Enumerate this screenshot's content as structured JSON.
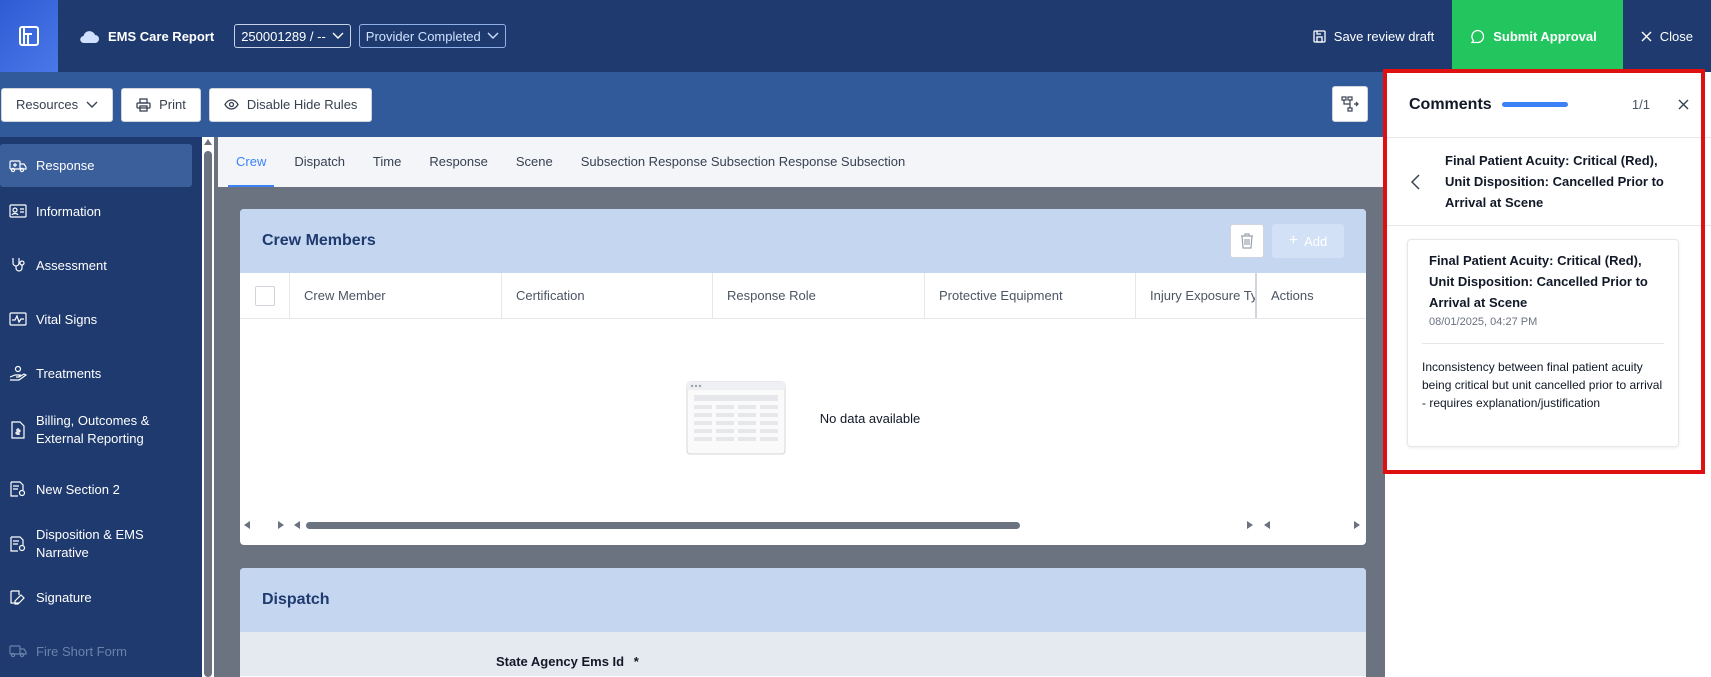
{
  "header": {
    "app_title": "EMS Care Report",
    "record_select": "250001289 / --",
    "status_select": "Provider Completed",
    "save_draft": "Save review draft",
    "submit": "Submit Approval",
    "close": "Close"
  },
  "toolbar": {
    "resources": "Resources",
    "print": "Print",
    "disable_hide_rules": "Disable Hide Rules"
  },
  "sidebar": {
    "items": [
      {
        "label": "Response",
        "icon": "ambulance-icon"
      },
      {
        "label": "Information",
        "icon": "id-card-icon"
      },
      {
        "label": "Assessment",
        "icon": "stethoscope-icon"
      },
      {
        "label": "Vital Signs",
        "icon": "heartbeat-icon"
      },
      {
        "label": "Treatments",
        "icon": "hand-care-icon"
      },
      {
        "label": "Billing, Outcomes &",
        "label2": "External Reporting",
        "icon": "invoice-icon"
      },
      {
        "label": "New Section 2",
        "icon": "document-icon"
      },
      {
        "label": "Disposition & EMS",
        "label2": "Narrative",
        "icon": "document-icon"
      },
      {
        "label": "Signature",
        "icon": "signature-icon"
      },
      {
        "label": "Fire Short Form",
        "icon": "truck-icon"
      }
    ]
  },
  "tabs": [
    "Crew",
    "Dispatch",
    "Time",
    "Response",
    "Scene",
    "Subsection Response Subsection Response Subsection"
  ],
  "crew_card": {
    "title": "Crew Members",
    "add_label": "Add",
    "columns": [
      "Crew Member",
      "Certification",
      "Response Role",
      "Protective Equipment",
      "Injury Exposure Ty",
      "Actions"
    ],
    "empty_text": "No data available"
  },
  "dispatch_card": {
    "title": "Dispatch",
    "field_label": "State Agency Ems Id",
    "required_mark": "*"
  },
  "comments": {
    "title": "Comments",
    "count": "1/1",
    "progress": 1.0,
    "subject_line1": "Final Patient Acuity: Critical (Red),",
    "subject_line2": "Unit Disposition: Cancelled Prior to",
    "subject_line3": "Arrival at Scene",
    "card": {
      "title_line1": "Final Patient Acuity: Critical (Red),",
      "title_line2": "Unit Disposition: Cancelled Prior to",
      "title_line3": "Arrival at Scene",
      "date": "08/01/2025, 04:27 PM",
      "body": "Inconsistency between final patient acuity being critical but unit cancelled prior to arrival - requires explanation/justification"
    }
  },
  "colors": {
    "header_bg": "#1e3a6e",
    "submit_bg": "#22c55e",
    "accent": "#3b82f6",
    "highlight": "#e01010"
  }
}
